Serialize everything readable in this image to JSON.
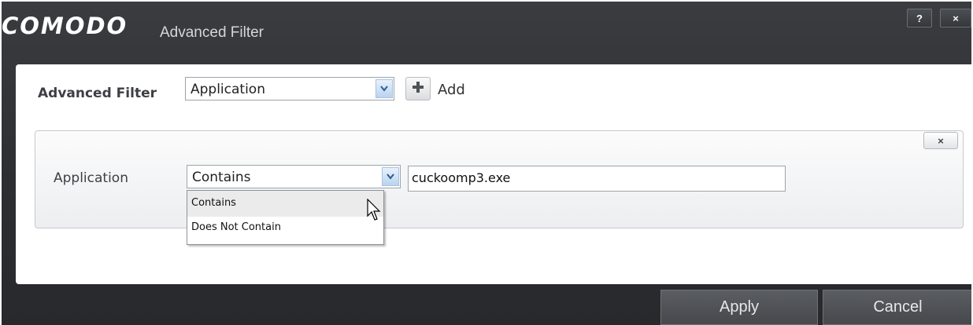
{
  "window": {
    "brand": "COMODO",
    "title": "Advanced Filter",
    "help_label": "?",
    "close_label": "×"
  },
  "filter": {
    "label": "Advanced Filter",
    "selected": "Application",
    "add_label": "Add"
  },
  "rule": {
    "label": "Application",
    "condition_selected": "Contains",
    "value": "cuckoomp3.exe",
    "remove_label": "×",
    "condition_options": [
      "Contains",
      "Does Not Contain"
    ],
    "hovered_option": "Contains"
  },
  "footer": {
    "apply_label": "Apply",
    "cancel_label": "Cancel"
  },
  "colors": {
    "titlebar": "#2c2e31",
    "accent_arrow": "#2e5b96",
    "add_plus": "#4f5257"
  }
}
